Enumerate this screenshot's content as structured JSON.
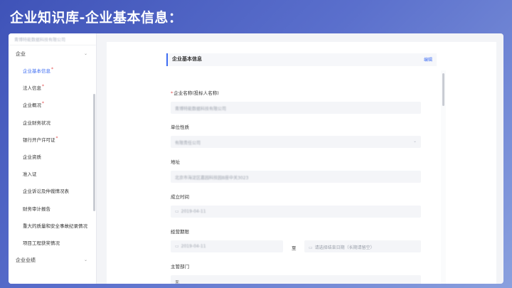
{
  "slide_title": "企业知识库-企业基本信息：",
  "sidebar": {
    "company_name": "青博特能数据科技有限公司",
    "group_1": "企业",
    "items": [
      {
        "label": "企业基本信息",
        "required": true,
        "active": true
      },
      {
        "label": "法人信息",
        "required": true,
        "active": false
      },
      {
        "label": "企业概况",
        "required": true,
        "active": false
      },
      {
        "label": "企业财务状况",
        "required": false,
        "active": false
      },
      {
        "label": "银行开户许可证",
        "required": true,
        "active": false
      },
      {
        "label": "企业资质",
        "required": false,
        "active": false
      },
      {
        "label": "准入证",
        "required": false,
        "active": false
      },
      {
        "label": "企业诉讼及仲裁情况表",
        "required": false,
        "active": false
      },
      {
        "label": "财务审计报告",
        "required": false,
        "active": false
      },
      {
        "label": "重大的质量和安全事故纪录情况",
        "required": false,
        "active": false
      },
      {
        "label": "项目工程获奖情况",
        "required": false,
        "active": false
      }
    ],
    "group_2": "企业业绩",
    "required_mark": "*",
    "chevron": "⌄"
  },
  "panel": {
    "title": "企业基本信息",
    "edit_label": "编辑"
  },
  "form": {
    "company_name_label": "企业名称(投标人名称)",
    "company_name_required": "*",
    "company_name_value": "青博特能数据科技有限公司",
    "unit_nature_label": "单位性质",
    "unit_nature_value": "有限责任公司",
    "address_label": "地址",
    "address_value": "北京市海淀区嘉园科技园B座中关3023",
    "established_label": "成立时间",
    "established_value": "2019-04-11",
    "business_term_label": "经营期限",
    "business_term_start": "2019-04-11",
    "business_term_sep": "至",
    "business_term_end_placeholder": "请选择结束日期（长期请留空）",
    "department_label": "主管部门",
    "department_value": "无",
    "calendar_glyph": "▭",
    "dropdown_glyph": "⌄"
  }
}
